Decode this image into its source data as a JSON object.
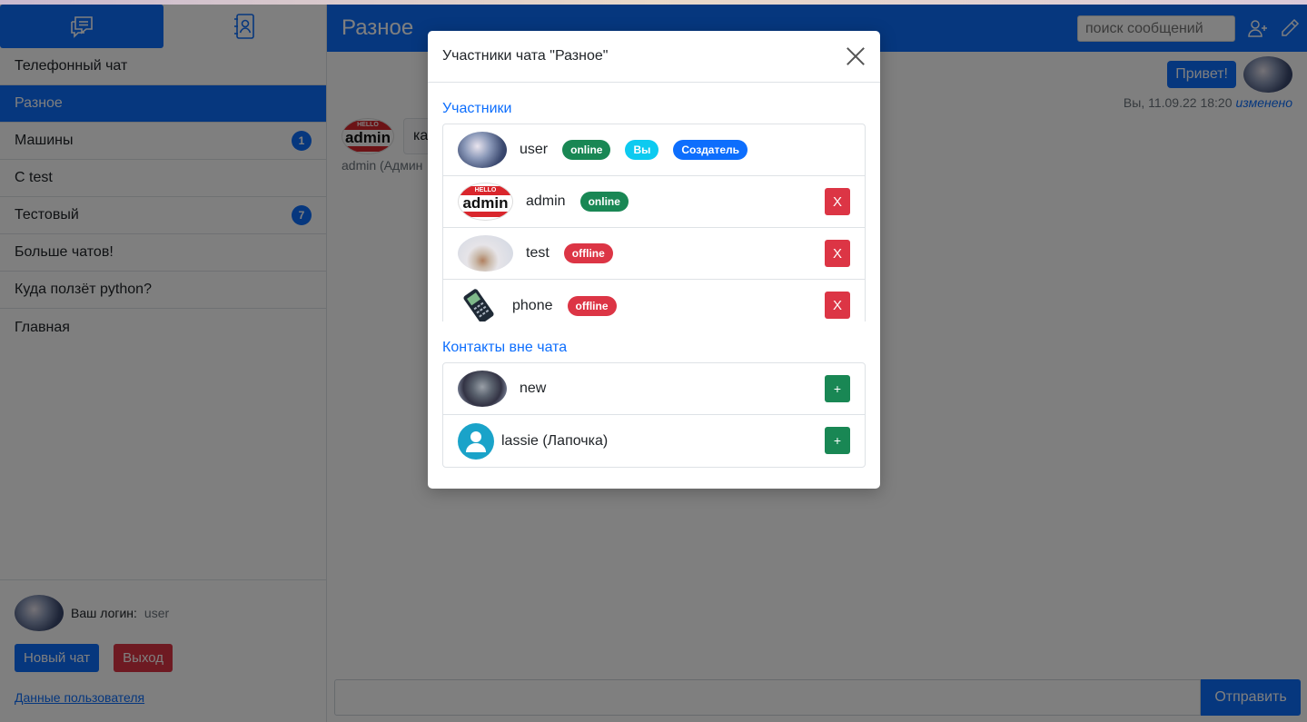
{
  "sidebar": {
    "chats": [
      {
        "name": "Телефонный чат",
        "count": ""
      },
      {
        "name": "Разное",
        "count": ""
      },
      {
        "name": "Машины",
        "count": "1"
      },
      {
        "name": "С test",
        "count": ""
      },
      {
        "name": "Тестовый",
        "count": "7"
      },
      {
        "name": "Больше чатов!",
        "count": ""
      },
      {
        "name": "Куда ползёт python?",
        "count": ""
      },
      {
        "name": "Главная",
        "count": ""
      }
    ],
    "login_label": "Ваш логин:",
    "login_value": "user",
    "new_chat_label": "Новый чат",
    "logout_label": "Выход",
    "user_data_link": "Данные пользователя"
  },
  "main": {
    "title": "Разное",
    "search_placeholder": "поиск сообщений",
    "out_message": "Привет!",
    "out_meta": "Вы, 11.09.22 18:20",
    "out_edited": "изменено",
    "in_message": "ка",
    "in_meta": "admin (Админ",
    "send_label": "Отправить"
  },
  "modal": {
    "title": "Участники чата \"Разное\"",
    "participants_title": "Участники",
    "participants": [
      {
        "name": "user",
        "status": "online",
        "you": "Вы",
        "creator": "Создатель"
      },
      {
        "name": "admin",
        "status": "online",
        "remove": "X"
      },
      {
        "name": "test",
        "status": "offline",
        "remove": "X"
      },
      {
        "name": "phone",
        "status": "offline",
        "remove": "X"
      }
    ],
    "contacts_title": "Контакты вне чата",
    "contacts": [
      {
        "name": "new",
        "add": "+"
      },
      {
        "name": "lassie (Лапочка)",
        "add": "+"
      }
    ]
  },
  "avatar_text": {
    "hello": "HELLO",
    "admin": "admin"
  },
  "colors": {
    "primary": "#0d6efd",
    "success": "#198754",
    "danger": "#dc3545",
    "info": "#0dcaf0"
  }
}
